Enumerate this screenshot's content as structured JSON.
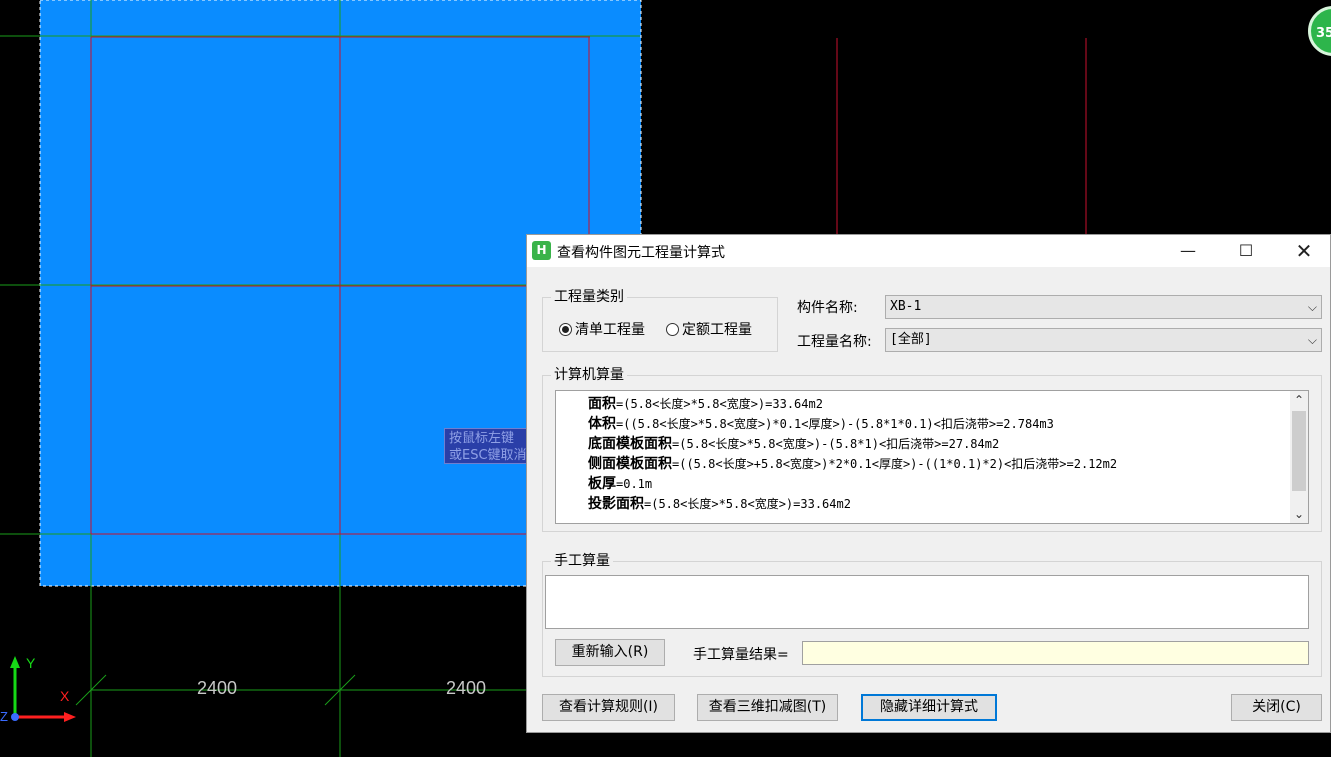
{
  "cad": {
    "dim_labels": [
      "2400",
      "2400"
    ],
    "axis_y": "Y",
    "axis_x": "X",
    "axis_z": "Z",
    "tooltip_lines": [
      "按鼠标左键",
      "或ESC键取消"
    ],
    "badge": "35",
    "colors": {
      "slab": "#0a8cff",
      "grid_red": "#c8102e",
      "grid_green": "#1a9e1a",
      "axis_y": "#16d916",
      "axis_x": "#ff2020"
    }
  },
  "dialog": {
    "title": "查看构件图元工程量计算式",
    "window_buttons": {
      "minimize": "—",
      "maximize": "☐",
      "close": "✕"
    },
    "category_group": {
      "label": "工程量类别",
      "options": [
        {
          "label": "清单工程量",
          "selected": true
        },
        {
          "label": "定额工程量",
          "selected": false
        }
      ]
    },
    "component_name": {
      "label": "构件名称:",
      "value": "XB-1"
    },
    "quantity_name": {
      "label": "工程量名称:",
      "value": "[全部]"
    },
    "computer_calc": {
      "label": "计算机算量",
      "lines": [
        {
          "name": "面积",
          "expr": "=(5.8<长度>*5.8<宽度>)=33.64m2"
        },
        {
          "name": "体积",
          "expr": "=((5.8<长度>*5.8<宽度>)*0.1<厚度>)-(5.8*1*0.1)<扣后浇带>=2.784m3"
        },
        {
          "name": "底面模板面积",
          "expr": "=(5.8<长度>*5.8<宽度>)-(5.8*1)<扣后浇带>=27.84m2"
        },
        {
          "name": "侧面模板面积",
          "expr": "=((5.8<长度>+5.8<宽度>)*2*0.1<厚度>)-((1*0.1)*2)<扣后浇带>=2.12m2"
        },
        {
          "name": "板厚",
          "expr": "=0.1m"
        },
        {
          "name": "投影面积",
          "expr": "=(5.8<长度>*5.8<宽度>)=33.64m2"
        }
      ]
    },
    "manual_calc": {
      "label": "手工算量",
      "reenter_button": "重新输入(R)",
      "result_label": "手工算量结果=",
      "result_value": ""
    },
    "footer": {
      "view_rules": "查看计算规则(I)",
      "view_3d": "查看三维扣减图(T)",
      "hide_detail": "隐藏详细计算式",
      "close": "关闭(C)"
    }
  }
}
